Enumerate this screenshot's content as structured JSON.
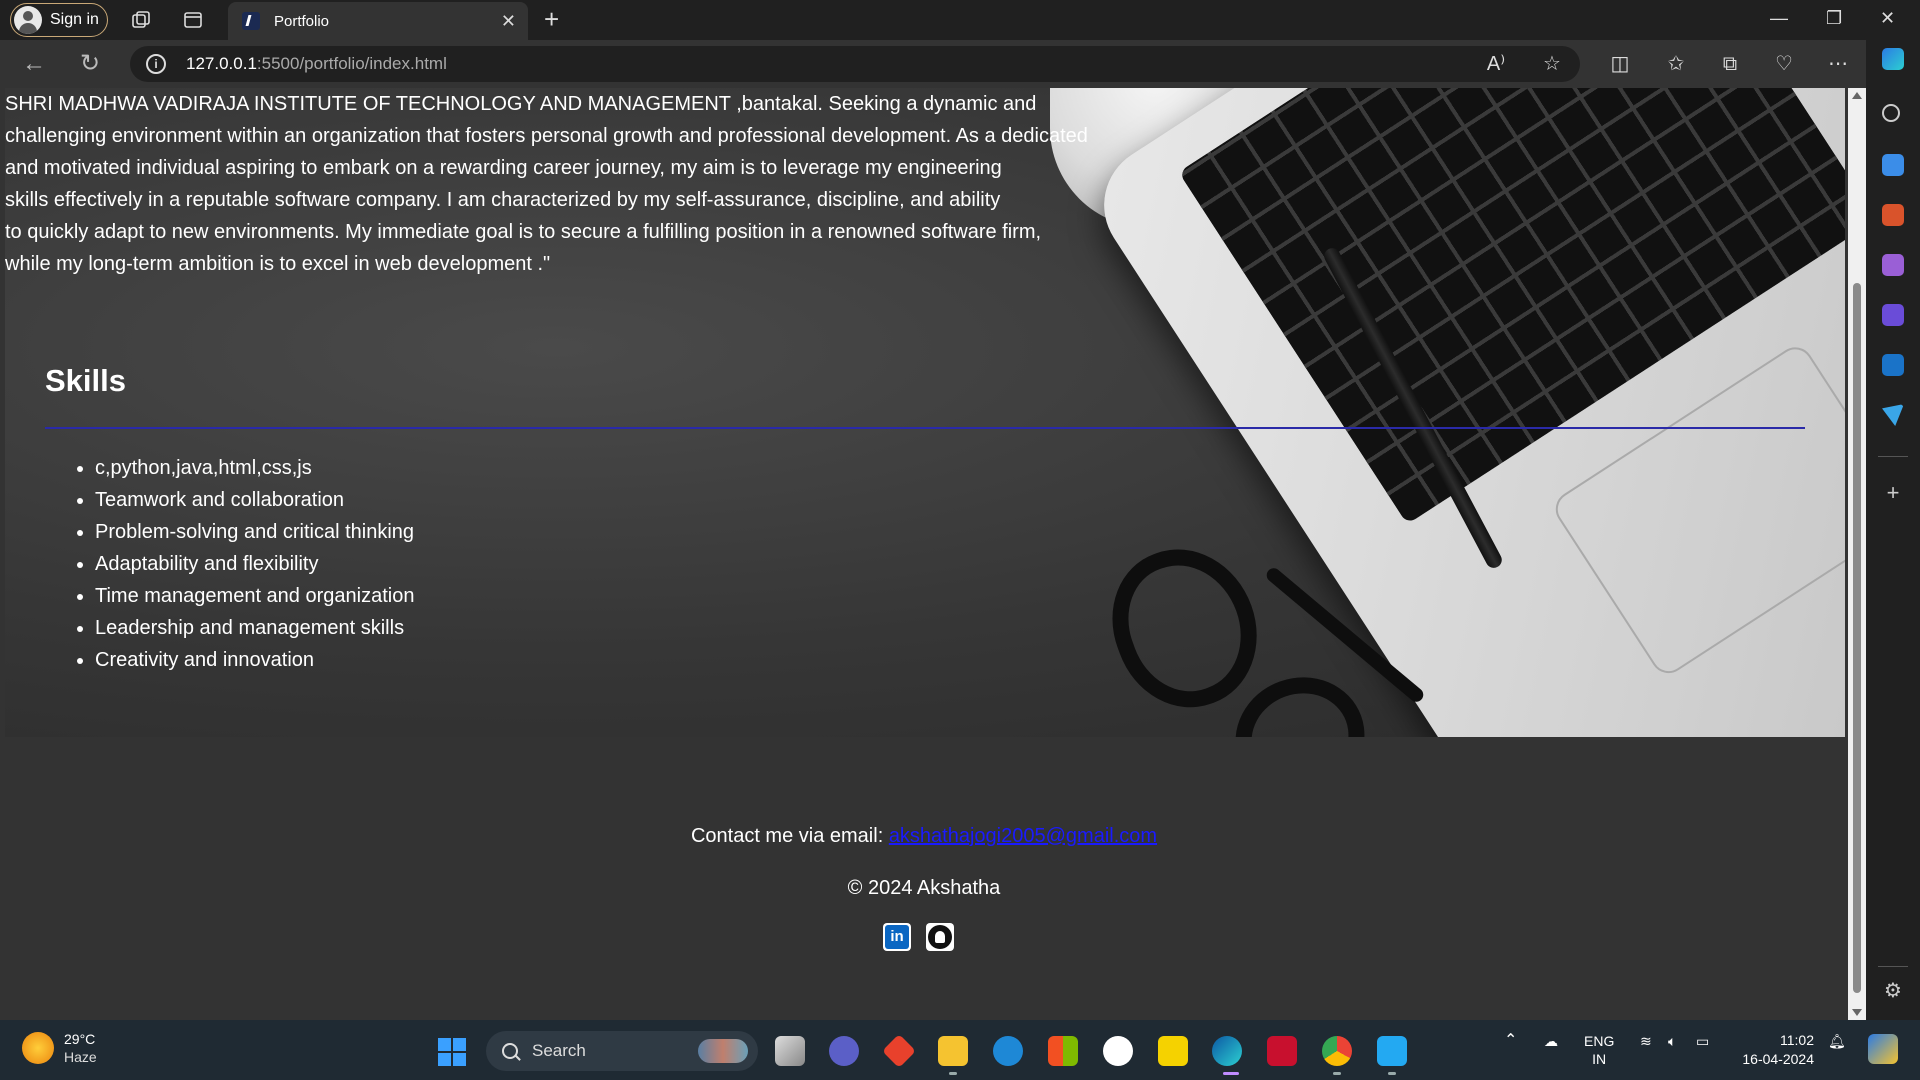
{
  "browser": {
    "signin_label": "Sign in",
    "tab_title": "Portfolio",
    "url_host": "127.0.0.1",
    "url_path": ":5500/portfolio/index.html"
  },
  "about": {
    "lines": [
      "SHRI MADHWA VADIRAJA INSTITUTE OF TECHNOLOGY AND MANAGEMENT ,bantakal. Seeking a dynamic and",
      "challenging environment within an organization that fosters personal growth and professional development. As a dedicated",
      "and motivated individual aspiring to embark on a rewarding career journey, my aim is to leverage my engineering",
      "skills effectively in a reputable software company. I am characterized by my self-assurance, discipline, and ability",
      "to quickly adapt to new environments. My immediate goal is to secure a fulfilling position in a renowned software firm,",
      "while my long-term ambition is to excel in web development .\""
    ]
  },
  "skills": {
    "heading": "Skills",
    "items": [
      "c,python,java,html,css,js",
      "Teamwork and collaboration",
      "Problem-solving and critical thinking",
      "Adaptability and flexibility",
      "Time management and organization",
      "Leadership and management skills",
      "Creativity and innovation"
    ]
  },
  "footer": {
    "contact_prefix": "Contact me via email: ",
    "email": "akshathajogi2005@gmail.com",
    "copyright": "© 2024 Akshatha",
    "social_icons": [
      "linkedin-icon",
      "github-icon"
    ]
  },
  "taskbar": {
    "weather_temp": "29°C",
    "weather_desc": "Haze",
    "search_label": "Search",
    "lang_line1": "ENG",
    "lang_line2": "IN",
    "time": "11:02",
    "date": "16-04-2024"
  },
  "colors": {
    "hr_line": "#2a2aa8",
    "link": "#1a1aff",
    "accent": "#3aa0ff"
  }
}
